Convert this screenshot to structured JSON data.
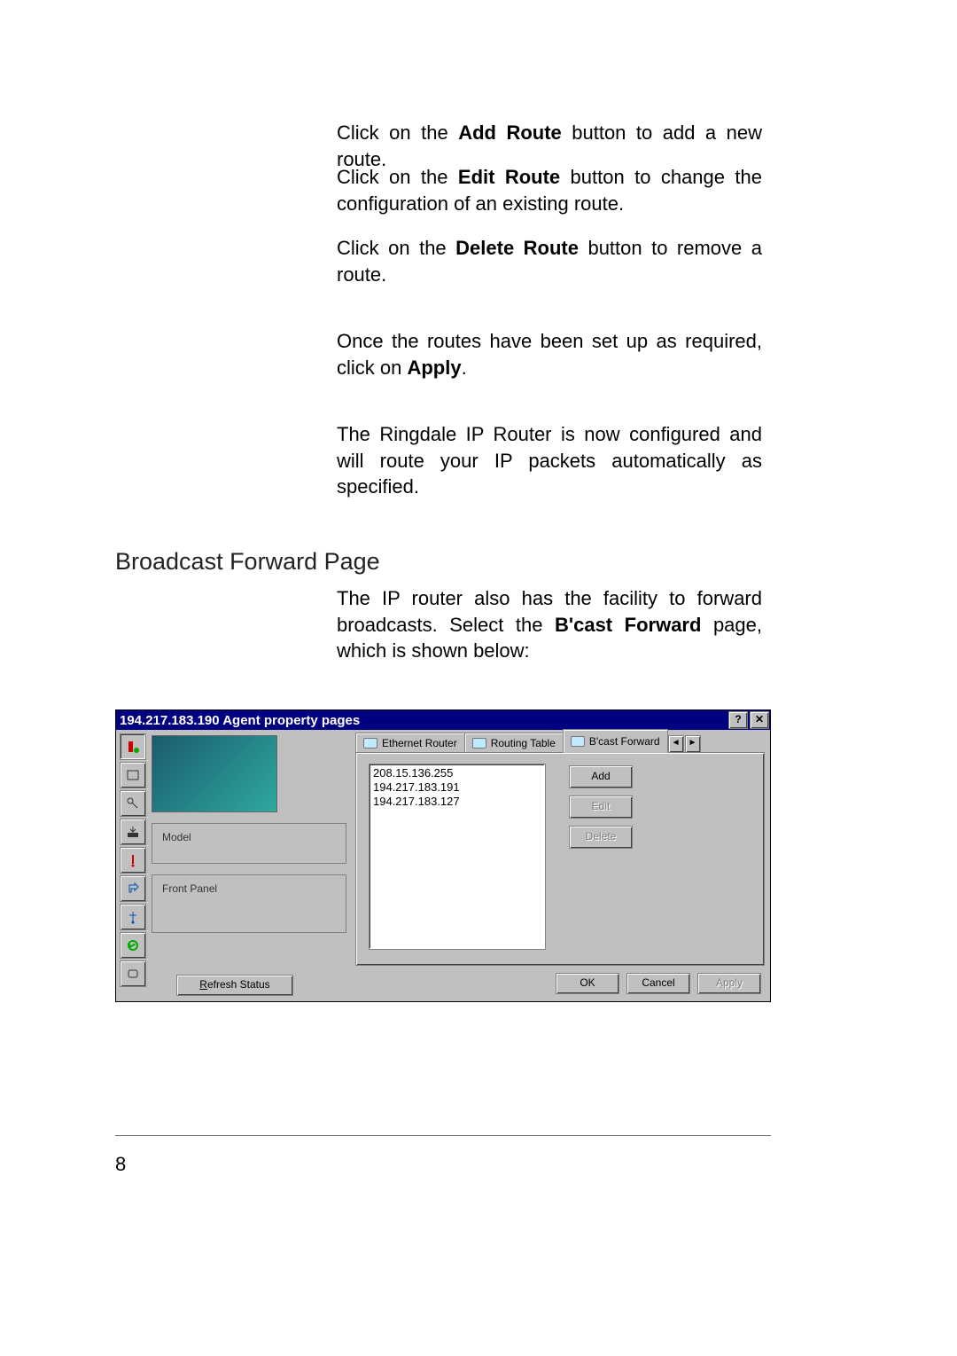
{
  "paragraphs": {
    "p1_pre": "Click on the ",
    "p1_bold": "Add Route",
    "p1_post": " button to add a new route.",
    "p2_pre": "Click on the ",
    "p2_bold": "Edit Route",
    "p2_post": " button to change the configuration of an existing route.",
    "p3_pre": "Click on the ",
    "p3_bold": "Delete Route",
    "p3_post": " button to remove a route.",
    "p4_pre": "Once the routes have been set up as required, click on ",
    "p4_bold": "Apply",
    "p4_post": ".",
    "p5": "The Ringdale IP Router is now configured and will route your IP packets automatically as specified.",
    "p6_pre": "The IP router also has the facility to forward broadcasts.  Select the ",
    "p6_bold": "B'cast Forward",
    "p6_post": " page, which is shown below:"
  },
  "section_heading": "Broadcast Forward Page",
  "dialog": {
    "title": "194.217.183.190 Agent property pages",
    "help_btn": "?",
    "close_btn": "✕",
    "tabs": {
      "ethernet": "Ethernet Router",
      "routing": "Routing Table",
      "bcast": "B'cast Forward",
      "left_arrow": "◄",
      "right_arrow": "►"
    },
    "list_items": [
      "208.15.136.255",
      "194.217.183.191",
      "194.217.183.127"
    ],
    "buttons": {
      "add": "Add",
      "edit": "Edit",
      "delete": "Delete"
    },
    "fieldsets": {
      "model": "Model",
      "front_panel": "Front Panel"
    },
    "refresh": "Refresh Status",
    "refresh_underline": "R",
    "bottom": {
      "ok": "OK",
      "cancel": "Cancel",
      "apply": "Apply"
    }
  },
  "page_number": "8"
}
